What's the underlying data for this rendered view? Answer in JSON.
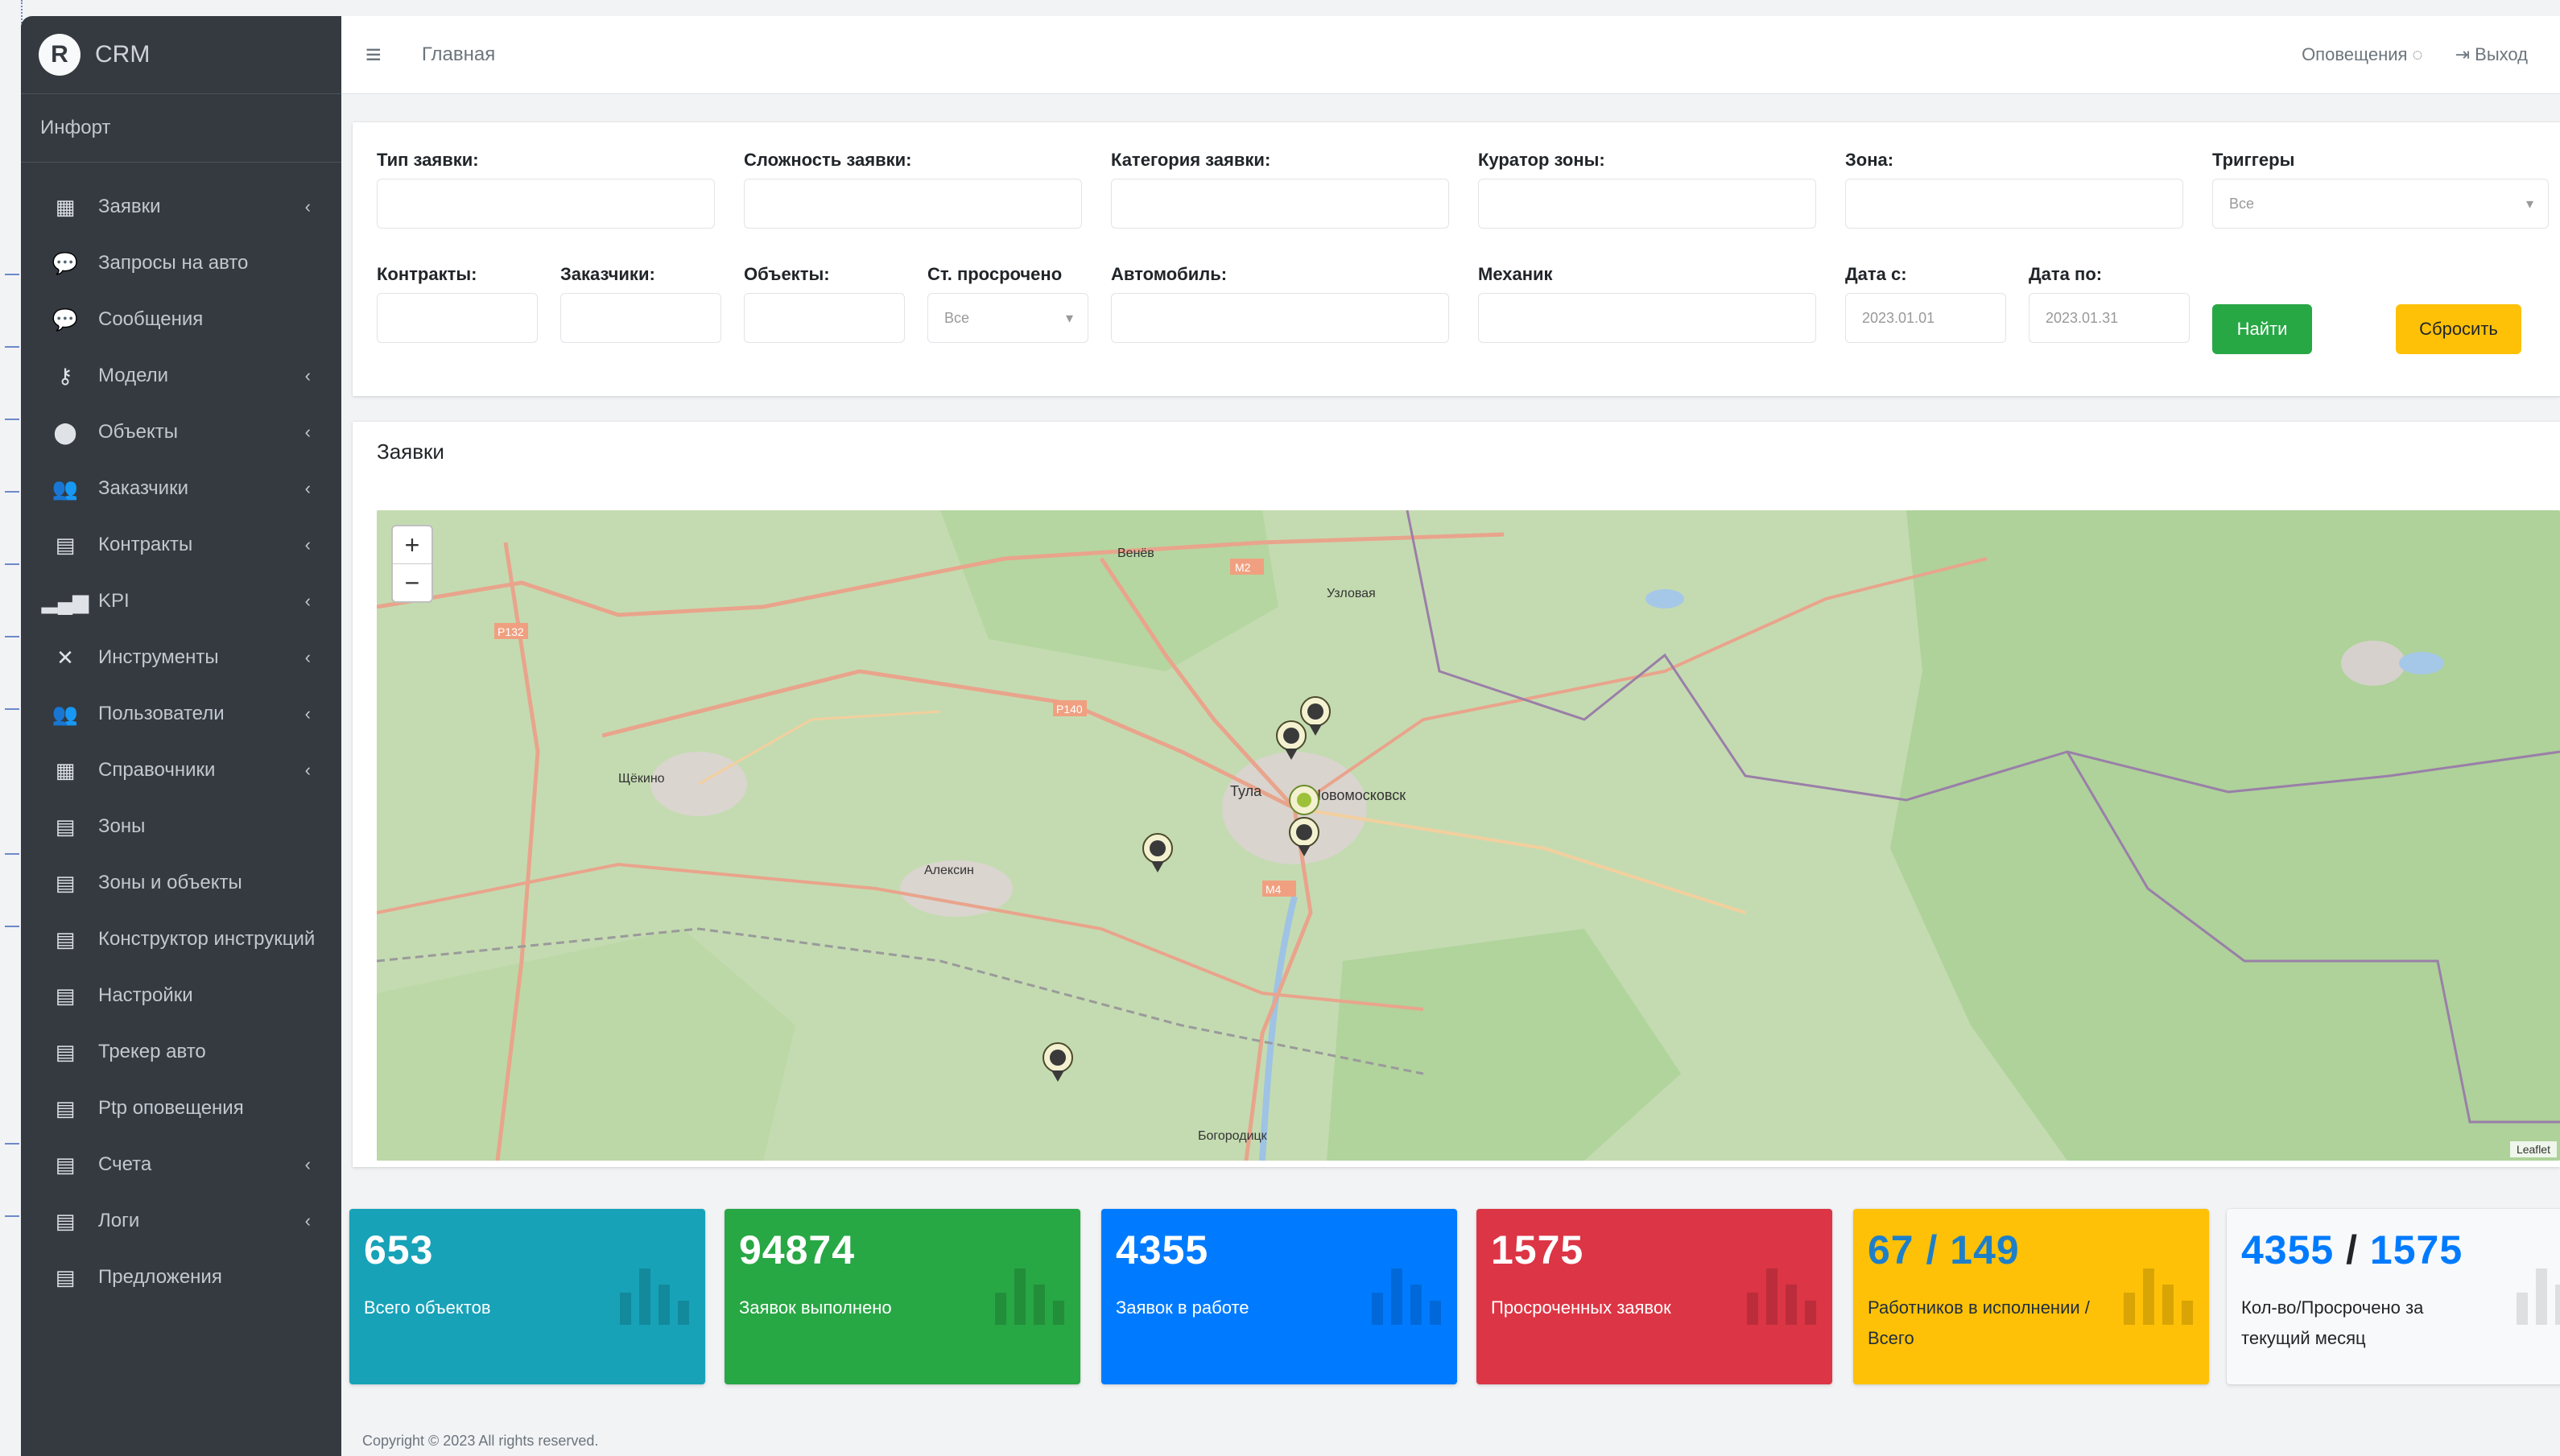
{
  "app": {
    "brand_logo": "R",
    "brand_name": "CRM",
    "user_name": "Инфорт"
  },
  "sidebar": {
    "items": [
      {
        "label": "Заявки",
        "icon": "building-icon",
        "glyph": "▦",
        "caret": true
      },
      {
        "label": "Запросы на авто",
        "icon": "chat-icon",
        "glyph": "💬",
        "caret": false
      },
      {
        "label": "Сообщения",
        "icon": "comments-icon",
        "glyph": "💬",
        "caret": false
      },
      {
        "label": "Модели",
        "icon": "key-icon",
        "glyph": "⚷",
        "caret": true
      },
      {
        "label": "Объекты",
        "icon": "map-marker-icon",
        "glyph": "⬤",
        "caret": true
      },
      {
        "label": "Заказчики",
        "icon": "users-icon",
        "glyph": "👥",
        "caret": true
      },
      {
        "label": "Контракты",
        "icon": "file-icon",
        "glyph": "▤",
        "caret": true
      },
      {
        "label": "KPI",
        "icon": "signal-icon",
        "glyph": "▂▄▆",
        "caret": true
      },
      {
        "label": "Инструменты",
        "icon": "tools-icon",
        "glyph": "✕",
        "caret": true
      },
      {
        "label": "Пользователи",
        "icon": "user-group-icon",
        "glyph": "👥",
        "caret": true
      },
      {
        "label": "Справочники",
        "icon": "book-icon",
        "glyph": "▦",
        "caret": true
      },
      {
        "label": "Зоны",
        "icon": "table-icon",
        "glyph": "▤",
        "caret": false
      },
      {
        "label": "Зоны и объекты",
        "icon": "table-icon",
        "glyph": "▤",
        "caret": false
      },
      {
        "label": "Конструктор инструкций",
        "icon": "table-icon",
        "glyph": "▤",
        "caret": false
      },
      {
        "label": "Настройки",
        "icon": "table-icon",
        "glyph": "▤",
        "caret": false
      },
      {
        "label": "Трекер авто",
        "icon": "table-icon",
        "glyph": "▤",
        "caret": false
      },
      {
        "label": "Ptp оповещения",
        "icon": "table-icon",
        "glyph": "▤",
        "caret": false
      },
      {
        "label": "Счета",
        "icon": "table-icon",
        "glyph": "▤",
        "caret": true
      },
      {
        "label": "Логи",
        "icon": "file-icon",
        "glyph": "▤",
        "caret": true
      },
      {
        "label": "Предложения",
        "icon": "table-icon",
        "glyph": "▤",
        "caret": false
      }
    ]
  },
  "topbar": {
    "menu_glyph": "≡",
    "home": "Главная",
    "notifications": "Оповещения ◌",
    "logout": "⇥ Выход"
  },
  "filters": {
    "type_label": "Тип заявки:",
    "complexity_label": "Сложность заявки:",
    "category_label": "Категория заявки:",
    "curator_label": "Куратор зоны:",
    "zone_label": "Зона:",
    "triggers_label": "Триггеры",
    "triggers_value": "Все",
    "contracts_label": "Контракты:",
    "customers_label": "Заказчики:",
    "objects_label": "Объекты:",
    "overdue_label": "Ст. просрочено",
    "overdue_value": "Все",
    "vehicle_label": "Автомобиль:",
    "mechanic_label": "Механик",
    "date_from_label": "Дата с:",
    "date_from_value": "2023.01.01",
    "date_to_label": "Дата по:",
    "date_to_value": "2023.01.31",
    "find_button": "Найти",
    "reset_button": "Сбросить"
  },
  "map": {
    "title": "Заявки",
    "zoom_in": "+",
    "zoom_out": "−",
    "attribution": "Leaflet",
    "place_labels": [
      "Тула",
      "Новомосковск",
      "Щёкино",
      "Алексин",
      "Узловая",
      "Венёв",
      "Богородицк"
    ],
    "road_labels": [
      "М2",
      "Р132",
      "Р140",
      "М4"
    ]
  },
  "stats": [
    {
      "value": "653",
      "label": "Всего объектов"
    },
    {
      "value": "94874",
      "label": "Заявок выполнено"
    },
    {
      "value": "4355",
      "label": "Заявок в работе"
    },
    {
      "value": "1575",
      "label": "Просроченных заявок"
    },
    {
      "value": "67 / 149",
      "label": "Работников в исполнении / Всего"
    },
    {
      "value_a": "4355",
      "sep": " / ",
      "value_b": "1575",
      "label": "Кол-во/Просрочено за текущий месяц"
    }
  ],
  "footer": "Copyright © 2023 All rights reserved."
}
